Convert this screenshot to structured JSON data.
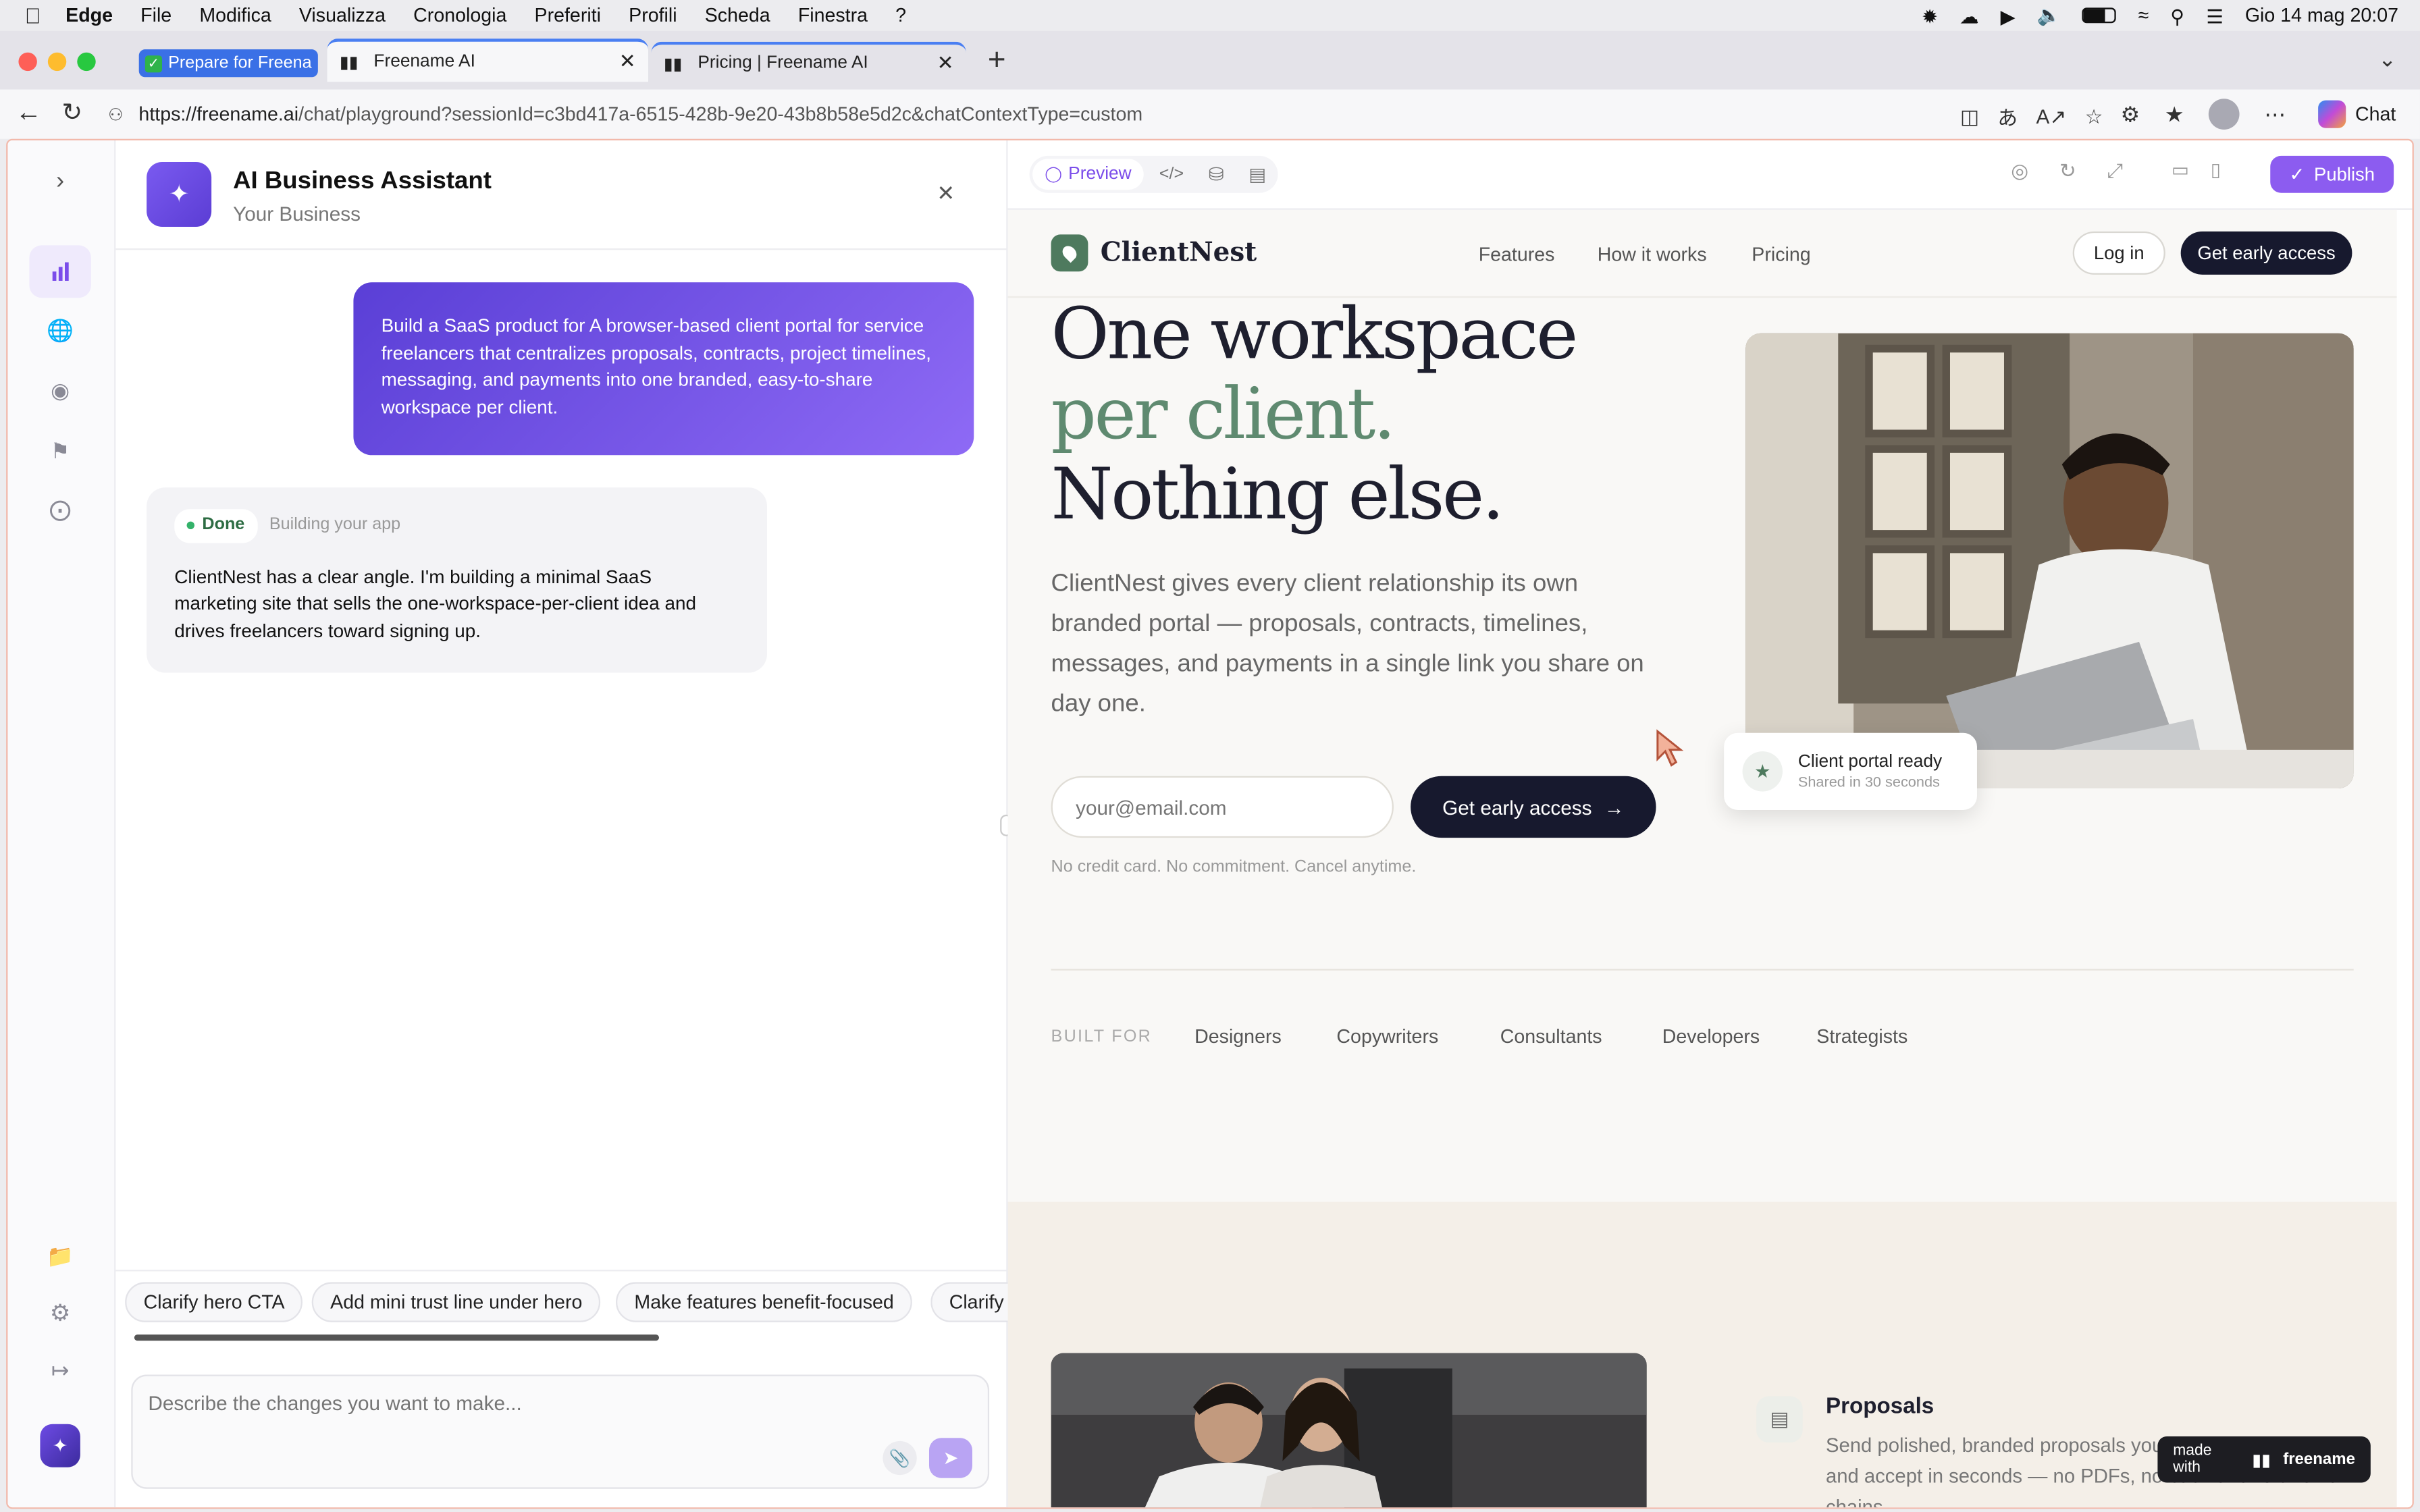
{
  "menubar": {
    "app": "Edge",
    "items": [
      "File",
      "Modifica",
      "Visualizza",
      "Cronologia",
      "Preferiti",
      "Profili",
      "Scheda",
      "Finestra",
      "?"
    ],
    "clock": "Gio 14 mag  20:07"
  },
  "tabs": [
    {
      "label": "Prepare for Freena"
    },
    {
      "label": "Freename AI"
    },
    {
      "label": "Pricing | Freename AI"
    }
  ],
  "address": {
    "url_domain": "https://freename.ai",
    "url_path": "/chat/playground?sessionId=c3bd417a-6515-428b-9e20-43b8b58e5d2c&chatContextType=custom",
    "chat_label": "Chat"
  },
  "assistant": {
    "title": "AI Business Assistant",
    "subtitle": "Your Business",
    "user_message": "Build a SaaS product for A browser-based client portal for service freelancers that centralizes proposals, contracts, project timelines, messaging, and payments into one branded, easy-to-share workspace per client.",
    "status": "Done",
    "status_note": "Building your app",
    "reply": "ClientNest has a clear angle. I'm building a minimal SaaS marketing site that sells the one-workspace-per-client idea and drives freelancers toward signing up.",
    "suggestions": [
      "Clarify hero CTA",
      "Add mini trust line under hero",
      "Make features benefit-focused",
      "Clarify"
    ],
    "input_placeholder": "Describe the changes you want to make..."
  },
  "toolbar": {
    "preview": "Preview",
    "publish": "Publish"
  },
  "site": {
    "brand": "ClientNest",
    "nav": [
      "Features",
      "How it works",
      "Pricing"
    ],
    "login": "Log in",
    "cta": "Get early access",
    "hero_line1": "One workspace",
    "hero_line2": "per client.",
    "hero_line3": "Nothing else.",
    "hero_text": "ClientNest gives every client relationship its own branded portal — proposals, contracts, timelines, messages, and payments in a single link you share on day one.",
    "email_placeholder": "your@email.com",
    "hero_cta": "Get early access",
    "fine_print": "No credit card. No commitment. Cancel anytime.",
    "card_title": "Client portal ready",
    "card_sub": "Shared in 30 seconds",
    "built_for_label": "BUILT FOR",
    "built_for": [
      "Designers",
      "Copywriters",
      "Consultants",
      "Developers",
      "Strategists"
    ],
    "feature_title": "Proposals",
    "feature_text": "Send polished, branded proposals your client can review and accept in seconds — no PDFs, no back-and-forth email chains."
  },
  "badge": {
    "made_with": "made with",
    "brand": "freename"
  },
  "colors": {
    "accent": "#7b4dea",
    "dark": "#17192e",
    "green": "#5f8a70",
    "cream": "#f5f1ea"
  }
}
